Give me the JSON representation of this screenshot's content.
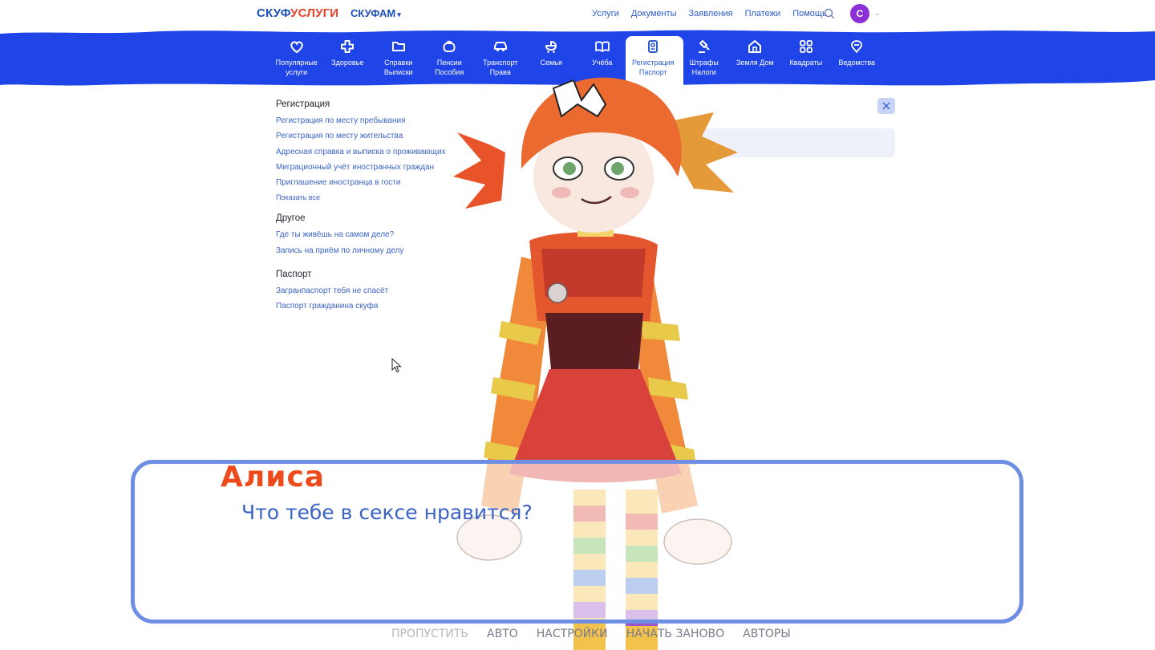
{
  "header": {
    "logo_part1": "СКУФ",
    "logo_part2": "УСЛУГИ",
    "family_label": "СКУФАМ",
    "nav": [
      "Услуги",
      "Документы",
      "Заявления",
      "Платежи",
      "Помощь"
    ],
    "avatar_letter": "С"
  },
  "categories": [
    {
      "label": "Популярные\nуслуги",
      "icon": "heart-icon"
    },
    {
      "label": "Здоровье",
      "icon": "medical-cross-icon"
    },
    {
      "label": "Справки\nВыписки",
      "icon": "folder-icon"
    },
    {
      "label": "Пенсии\nПособия",
      "icon": "wallet-icon"
    },
    {
      "label": "Транспорт\nПрава",
      "icon": "car-icon"
    },
    {
      "label": "Семья",
      "icon": "stroller-icon"
    },
    {
      "label": "Учёба",
      "icon": "book-icon"
    },
    {
      "label": "Регистрация\nПаспорт",
      "icon": "passport-icon",
      "active": true
    },
    {
      "label": "Штрафы\nНалоги",
      "icon": "gavel-icon"
    },
    {
      "label": "Земля Дом",
      "icon": "house-icon"
    },
    {
      "label": "Квадраты",
      "icon": "grid-icon"
    },
    {
      "label": "Ведомства",
      "icon": "emblem-icon"
    }
  ],
  "menu": {
    "registration": {
      "title": "Регистрация",
      "links": [
        "Регистрация по месту пребывания",
        "Регистрация по месту жительства",
        "Адресная справка и выписка о проживающих",
        "Миграционный учёт иностранных граждан",
        "Приглашение иностранца в гости"
      ],
      "show_all": "Показать все"
    },
    "other": {
      "title": "Другое",
      "links": [
        "Где ты живёшь на самом деле?",
        "Запись на приём по личному делу"
      ]
    },
    "passport": {
      "title": "Паспорт",
      "links": [
        "Загранпаспорт тебя не спасёт",
        "Паспорт гражданина скуфа"
      ]
    }
  },
  "dialogue": {
    "speaker": "Алиса",
    "text": "Что тебе в сексе нравится?"
  },
  "quick_menu": {
    "skip": "ПРОПУСТИТЬ",
    "auto": "АВТО",
    "settings": "НАСТРОЙКИ",
    "restart": "НАЧАТЬ ЗАНОВО",
    "authors": "АВТОРЫ"
  },
  "colors": {
    "band": "#1f44e8",
    "speaker": "#ee4b1d",
    "dialogue_text": "#3a63c5",
    "dialog_border": "#6d8ee3",
    "avatar": "#8b2fd6"
  }
}
